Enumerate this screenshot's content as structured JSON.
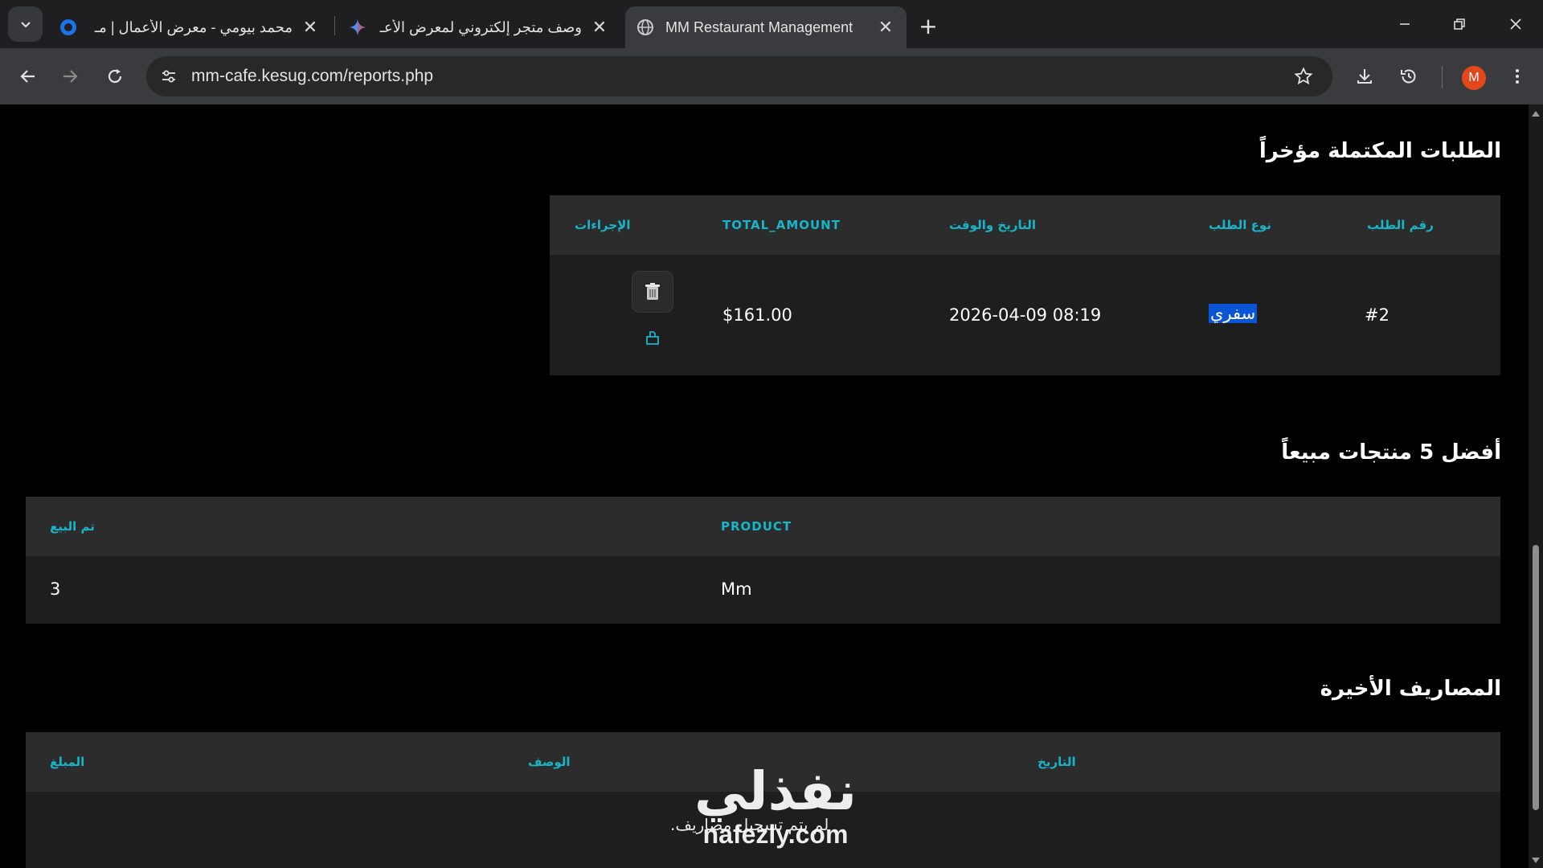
{
  "browser": {
    "tabs": [
      {
        "title": "محمد بيومي - معرض الأعمال | مـ",
        "favicon": "circle-logo-icon"
      },
      {
        "title": "وصف متجر إلكتروني لمعرض الأعـ",
        "favicon": "gemini-sparkle-icon"
      },
      {
        "title": "MM Restaurant Management",
        "favicon": "globe-icon"
      }
    ],
    "url": "mm-cafe.kesug.com/reports.php",
    "profile_initial": "M",
    "accent_colors": {
      "avatar": "#e2481b",
      "tab_active": "#3a3b3e"
    }
  },
  "completed_orders": {
    "title": "الطلبات المكتملة مؤخراً",
    "headers": {
      "order_no": "رقم الطلب",
      "order_type": "نوع الطلب",
      "datetime": "التاريخ والوقت",
      "total": "TOTAL_AMOUNT",
      "actions": "الإجراءات"
    },
    "rows": [
      {
        "order_no": "#2",
        "order_type": "سفري",
        "datetime": "2026-04-09 08:19",
        "total": "$161.00"
      }
    ]
  },
  "top_products": {
    "title": "أفضل 5 منتجات مبيعاً",
    "headers": {
      "product": "PRODUCT",
      "sold": "تم البيع"
    },
    "rows": [
      {
        "product": "Mm",
        "sold": "3"
      }
    ]
  },
  "recent_expenses": {
    "title": "المصاريف الأخيرة",
    "headers": {
      "date": "التاريخ",
      "description": "الوصف",
      "amount": "المبلغ"
    },
    "empty_message": "لم يتم تسجيل مصاريف."
  },
  "watermark": {
    "logo": "نفذلي",
    "url": "nafezly.com"
  },
  "theme": {
    "accent": "#16b5c9",
    "header_bg": "#2c2c2c",
    "row_bg": "#1e1e1e",
    "selection": "#0a55d6"
  }
}
